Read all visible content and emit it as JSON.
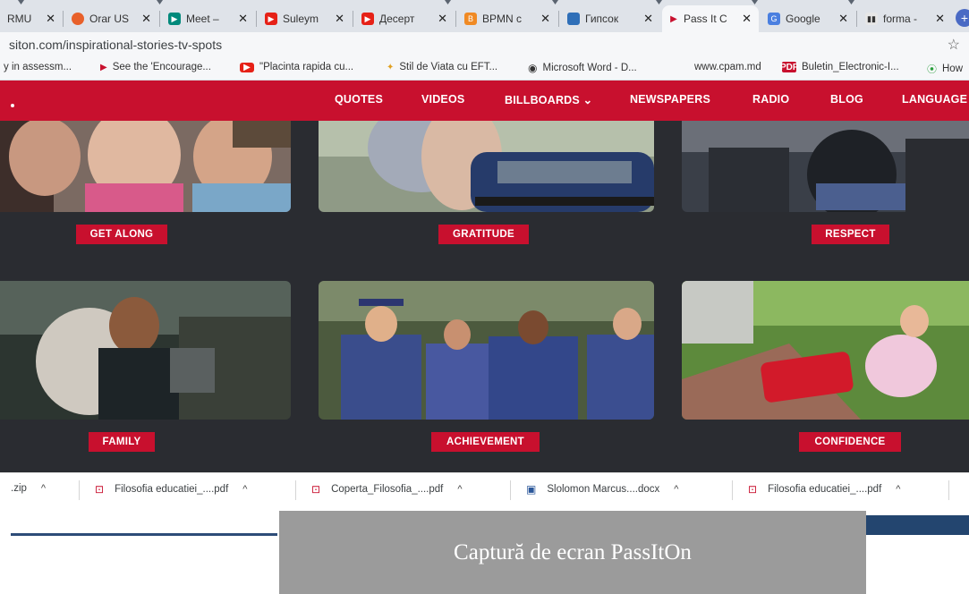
{
  "browser": {
    "tabs": [
      {
        "label": "RMU",
        "favicon": "generic-icon",
        "active": false
      },
      {
        "label": "Orar US",
        "favicon": "red-circle-icon",
        "active": false
      },
      {
        "label": "Meet –",
        "favicon": "meet-icon",
        "active": false
      },
      {
        "label": "Suleym",
        "favicon": "youtube-icon",
        "active": false
      },
      {
        "label": "Десерт",
        "favicon": "youtube-icon",
        "active": false
      },
      {
        "label": "BPMN c",
        "favicon": "bpmn-icon",
        "active": false
      },
      {
        "label": "Гипсок",
        "favicon": "site-icon",
        "active": false
      },
      {
        "label": "Pass It C",
        "favicon": "play-icon",
        "active": true
      },
      {
        "label": "Google",
        "favicon": "translate-icon",
        "active": false
      },
      {
        "label": "forma -",
        "favicon": "document-icon",
        "active": false
      }
    ],
    "close_glyph": "✕",
    "new_tab_glyph": "+",
    "url": "siton.com/inspirational-stories-tv-spots",
    "star_glyph": "☆",
    "bookmarks": [
      {
        "label": "y in assessm...",
        "icon": ""
      },
      {
        "label": "See the 'Encourage...",
        "icon": "play-icon"
      },
      {
        "label": "\"Placinta rapida cu...",
        "icon": "youtube-icon"
      },
      {
        "label": "Stil de Viata cu EFT...",
        "icon": "leaf-icon"
      },
      {
        "label": "Microsoft Word - D...",
        "icon": "globe-icon"
      },
      {
        "label": "www.cpam.md",
        "icon": ""
      },
      {
        "label": "Buletin_Electronic-I...",
        "icon": "pdf-icon"
      },
      {
        "label": "How",
        "icon": "play-circle-icon"
      }
    ]
  },
  "site": {
    "nav": [
      "QUOTES",
      "VIDEOS",
      "BILLBOARDS ⌄",
      "NEWSPAPERS",
      "RADIO",
      "BLOG",
      "LANGUAGE"
    ],
    "cards_row1": [
      {
        "button": "GET ALONG"
      },
      {
        "button": "GRATITUDE"
      },
      {
        "button": "RESPECT"
      }
    ],
    "cards_row2": [
      {
        "button": "FAMILY"
      },
      {
        "button": "ACHIEVEMENT"
      },
      {
        "button": "CONFIDENCE"
      }
    ],
    "colors": {
      "brand_red": "#c8102e",
      "background": "#2a2c31"
    }
  },
  "downloads": [
    {
      "label": ".zip",
      "icon": ""
    },
    {
      "label": "Filosofia educatiei_....pdf",
      "icon": "pdf-icon"
    },
    {
      "label": "Coperta_Filosofia_....pdf",
      "icon": "pdf-icon"
    },
    {
      "label": "Slolomon Marcus....docx",
      "icon": "word-icon"
    },
    {
      "label": "Filosofia educatiei_....pdf",
      "icon": "pdf-icon"
    }
  ],
  "caret_glyph": "^",
  "caption": "Captură de ecran PassItOn"
}
